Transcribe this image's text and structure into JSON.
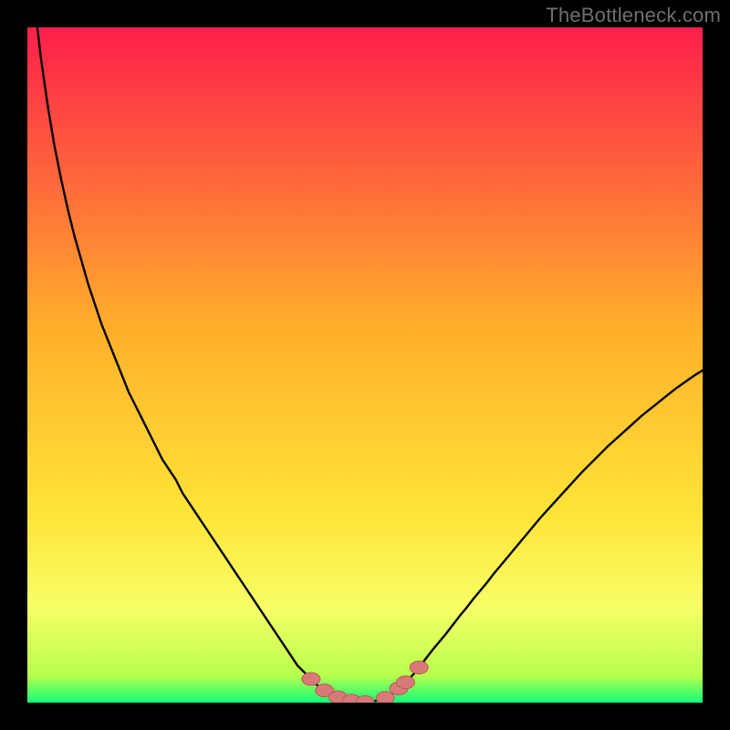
{
  "watermark": {
    "text": "TheBottleneck.com"
  },
  "colors": {
    "bg": "#000000",
    "curve": "#000000",
    "marker_fill": "#d77a78",
    "marker_stroke": "#b85a58",
    "grad_top": "#ff1f4b",
    "grad_mid1": "#ff7a2a",
    "grad_mid2": "#ffe438",
    "grad_band": "#f7ff66",
    "grad_bottom": "#12ff7a"
  },
  "chart_data": {
    "type": "line",
    "x": [
      0,
      1,
      2,
      3,
      4,
      5,
      6,
      7,
      8,
      9,
      10,
      11,
      12,
      13,
      14,
      15,
      16,
      17,
      18,
      19,
      20,
      21,
      22,
      23,
      24,
      25,
      26,
      27,
      28,
      29,
      30,
      31,
      32,
      33,
      34,
      35,
      36,
      37,
      38,
      39,
      40,
      41,
      42,
      43,
      44,
      45,
      46,
      47,
      48,
      49,
      50,
      51,
      52,
      53,
      54,
      55,
      56,
      57,
      58,
      59,
      60,
      61,
      62,
      63,
      64,
      65,
      66,
      67,
      68,
      69,
      70,
      71,
      72,
      73,
      74,
      75,
      76,
      77,
      78,
      79,
      80,
      81,
      82,
      83,
      84,
      85,
      86,
      87,
      88,
      89,
      90,
      91,
      92,
      93,
      94,
      95,
      96,
      97,
      98,
      99,
      100
    ],
    "values": [
      115,
      104,
      95.5,
      88.5,
      82.5,
      77.5,
      73,
      69,
      65.5,
      62,
      59,
      56,
      53.5,
      51,
      48.5,
      46,
      44,
      42,
      40,
      38,
      36,
      34.5,
      33,
      31,
      29.5,
      28,
      26.5,
      25,
      23.5,
      22,
      20.5,
      19,
      17.5,
      16,
      14.5,
      13,
      11.5,
      10,
      8.5,
      7,
      5.5,
      4.5,
      3.5,
      2.5,
      1.8,
      1.2,
      0.8,
      0.5,
      0.3,
      0.15,
      0.08,
      0.15,
      0.35,
      0.7,
      1.3,
      2.1,
      3,
      4,
      5.2,
      6.5,
      7.8,
      9,
      10.2,
      11.5,
      12.8,
      14,
      15.3,
      16.5,
      17.7,
      19,
      20.2,
      21.4,
      22.6,
      23.8,
      25,
      26.2,
      27.4,
      28.5,
      29.6,
      30.7,
      31.8,
      32.9,
      34,
      35,
      36,
      37,
      38,
      38.9,
      39.8,
      40.7,
      41.6,
      42.5,
      43.3,
      44.1,
      44.9,
      45.7,
      46.5,
      47.2,
      47.9,
      48.6,
      49.2
    ],
    "markers_x": [
      42,
      44,
      46,
      48,
      50,
      53,
      55,
      56,
      58
    ],
    "markers_y": [
      3.5,
      1.8,
      0.8,
      0.3,
      0.08,
      0.7,
      2.1,
      3,
      5.2
    ],
    "xlabel": "",
    "ylabel": "",
    "title": "",
    "xlim": [
      0,
      100
    ],
    "ylim": [
      0,
      100
    ]
  }
}
